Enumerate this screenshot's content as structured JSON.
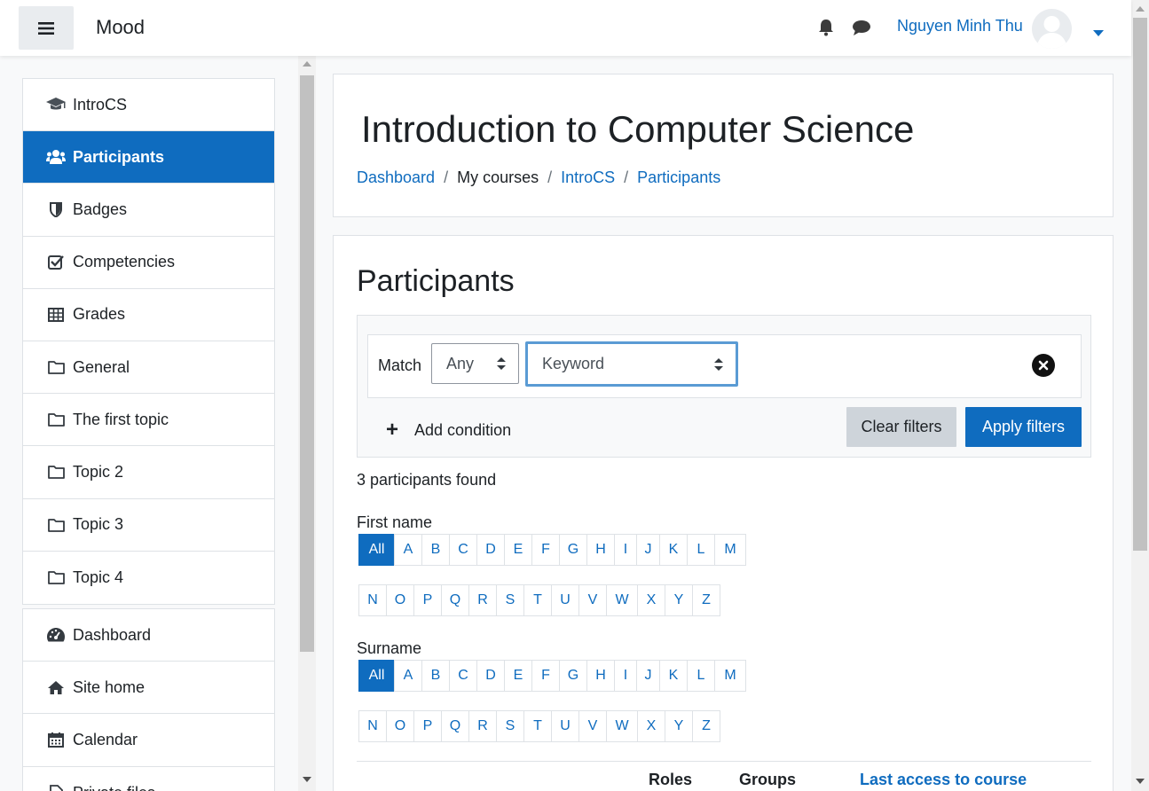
{
  "app": {
    "brand": "Mood"
  },
  "user": {
    "name": "Nguyen Minh Thu"
  },
  "nav": {
    "course_items": [
      {
        "label": "IntroCS",
        "icon": "graduation-cap-icon",
        "active": false
      },
      {
        "label": "Participants",
        "icon": "users-icon",
        "active": true
      },
      {
        "label": "Badges",
        "icon": "shield-icon",
        "active": false
      },
      {
        "label": "Competencies",
        "icon": "check-square-icon",
        "active": false
      },
      {
        "label": "Grades",
        "icon": "table-icon",
        "active": false
      },
      {
        "label": "General",
        "icon": "folder-icon",
        "active": false
      },
      {
        "label": "The first topic",
        "icon": "folder-icon",
        "active": false
      },
      {
        "label": "Topic 2",
        "icon": "folder-icon",
        "active": false
      },
      {
        "label": "Topic 3",
        "icon": "folder-icon",
        "active": false
      },
      {
        "label": "Topic 4",
        "icon": "folder-icon",
        "active": false
      }
    ],
    "site_items": [
      {
        "label": "Dashboard",
        "icon": "dashboard-icon"
      },
      {
        "label": "Site home",
        "icon": "home-icon"
      },
      {
        "label": "Calendar",
        "icon": "calendar-icon"
      },
      {
        "label": "Private files",
        "icon": "file-icon"
      }
    ]
  },
  "header": {
    "course_title": "Introduction to Computer Science",
    "breadcrumb": [
      "Dashboard",
      "My courses",
      "IntroCS",
      "Participants"
    ],
    "separator": "/"
  },
  "participants": {
    "title": "Participants",
    "match_label": "Match",
    "match_value": "Any",
    "filter_type": "Keyword",
    "add_condition": "Add condition",
    "clear_filters": "Clear filters",
    "apply_filters": "Apply filters",
    "found_text": "3 participants found",
    "first_name_label": "First name",
    "surname_label": "Surname",
    "letters_row1": [
      "All",
      "A",
      "B",
      "C",
      "D",
      "E",
      "F",
      "G",
      "H",
      "I",
      "J",
      "K",
      "L",
      "M"
    ],
    "letters_row2": [
      "N",
      "O",
      "P",
      "Q",
      "R",
      "S",
      "T",
      "U",
      "V",
      "W",
      "X",
      "Y",
      "Z"
    ],
    "columns": {
      "roles": "Roles",
      "groups": "Groups",
      "last_access": "Last access to course"
    }
  },
  "colors": {
    "accent": "#0f6cbf",
    "focus": "#5a9bd4"
  }
}
